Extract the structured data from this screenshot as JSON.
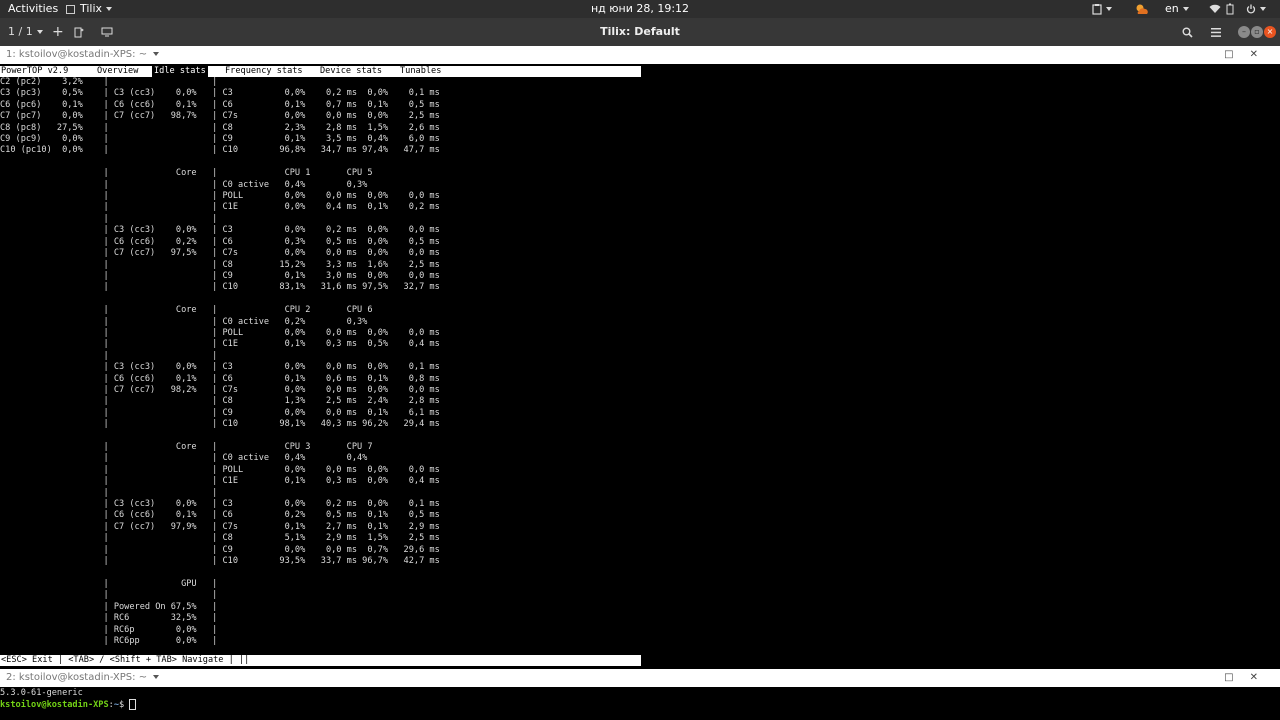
{
  "topbar": {
    "activities": "Activities",
    "app_menu": "Tilix",
    "clock": "нд юни 28, 19:12",
    "language": "en"
  },
  "headerbar": {
    "session_counter": "1 / 1",
    "add_label": "+",
    "title": "Tilix: Default"
  },
  "pane1": {
    "title": "1: kstoilov@kostadin-XPS: ~",
    "tabs": {
      "app": "PowerTOP v2.9",
      "overview": "Overview",
      "idle": "Idle stats",
      "frequency": "Frequency stats",
      "device": "Device stats",
      "tunables": "Tunables"
    },
    "body": "C2 (pc2)    3,2%    |                    |\nC3 (pc3)    0,5%    | C3 (cc3)    0,0%   | C3          0,0%    0,2 ms  0,0%    0,1 ms\nC6 (pc6)    0,1%    | C6 (cc6)    0,1%   | C6          0,1%    0,7 ms  0,1%    0,5 ms\nC7 (pc7)    0,0%    | C7 (cc7)   98,7%   | C7s         0,0%    0,0 ms  0,0%    2,5 ms\nC8 (pc8)   27,5%    |                    | C8          2,3%    2,8 ms  1,5%    2,6 ms\nC9 (pc9)    0,0%    |                    | C9          0,1%    3,5 ms  0,4%    6,0 ms\nC10 (pc10)  0,0%    |                    | C10        96,8%   34,7 ms 97,4%   47,7 ms\n\n                    |             Core   |             CPU 1       CPU 5\n                    |                    | C0 active   0,4%        0,3%\n                    |                    | POLL        0,0%    0,0 ms  0,0%    0,0 ms\n                    |                    | C1E         0,0%    0,4 ms  0,1%    0,2 ms\n                    |                    |\n                    | C3 (cc3)    0,0%   | C3          0,0%    0,2 ms  0,0%    0,0 ms\n                    | C6 (cc6)    0,2%   | C6          0,3%    0,5 ms  0,0%    0,5 ms\n                    | C7 (cc7)   97,5%   | C7s         0,0%    0,0 ms  0,0%    0,0 ms\n                    |                    | C8         15,2%    3,3 ms  1,6%    2,5 ms\n                    |                    | C9          0,1%    3,0 ms  0,0%    0,0 ms\n                    |                    | C10        83,1%   31,6 ms 97,5%   32,7 ms\n\n                    |             Core   |             CPU 2       CPU 6\n                    |                    | C0 active   0,2%        0,3%\n                    |                    | POLL        0,0%    0,0 ms  0,0%    0,0 ms\n                    |                    | C1E         0,1%    0,3 ms  0,5%    0,4 ms\n                    |                    |\n                    | C3 (cc3)    0,0%   | C3          0,0%    0,0 ms  0,0%    0,1 ms\n                    | C6 (cc6)    0,1%   | C6          0,1%    0,6 ms  0,1%    0,8 ms\n                    | C7 (cc7)   98,2%   | C7s         0,0%    0,0 ms  0,0%    0,0 ms\n                    |                    | C8          1,3%    2,5 ms  2,4%    2,8 ms\n                    |                    | C9          0,0%    0,0 ms  0,1%    6,1 ms\n                    |                    | C10        98,1%   40,3 ms 96,2%   29,4 ms\n\n                    |             Core   |             CPU 3       CPU 7\n                    |                    | C0 active   0,4%        0,4%\n                    |                    | POLL        0,0%    0,0 ms  0,0%    0,0 ms\n                    |                    | C1E         0,1%    0,3 ms  0,0%    0,4 ms\n                    |                    |\n                    | C3 (cc3)    0,0%   | C3          0,0%    0,2 ms  0,0%    0,1 ms\n                    | C6 (cc6)    0,1%   | C6          0,2%    0,5 ms  0,1%    0,5 ms\n                    | C7 (cc7)   97,9%   | C7s         0,1%    2,7 ms  0,1%    2,9 ms\n                    |                    | C8          5,1%    2,9 ms  1,5%    2,5 ms\n                    |                    | C9          0,0%    0,0 ms  0,7%   29,6 ms\n                    |                    | C10        93,5%   33,7 ms 96,7%   42,7 ms\n\n                    |              GPU   |\n                    |                    |\n                    | Powered On 67,5%   |\n                    | RC6        32,5%   |\n                    | RC6p        0,0%   |\n                    | RC6pp       0,0%   |",
    "footer": "<ESC> Exit | <TAB> / <Shift + TAB> Navigate | ||"
  },
  "pane2": {
    "title": "2: kstoilov@kostadin-XPS: ~",
    "output_line": "5.3.0-61-generic",
    "prompt_user": "kstoilov@kostadin-XPS",
    "prompt_sep": ":",
    "prompt_path": "~",
    "prompt_end": "$ "
  },
  "colors": {
    "topbar_bg": "#2e2e2e",
    "headerbar_bg": "#373737",
    "terminal_bg": "#000000",
    "prompt_user": "#73d216",
    "prompt_path": "#729fcf",
    "close_button": "#e95420"
  }
}
